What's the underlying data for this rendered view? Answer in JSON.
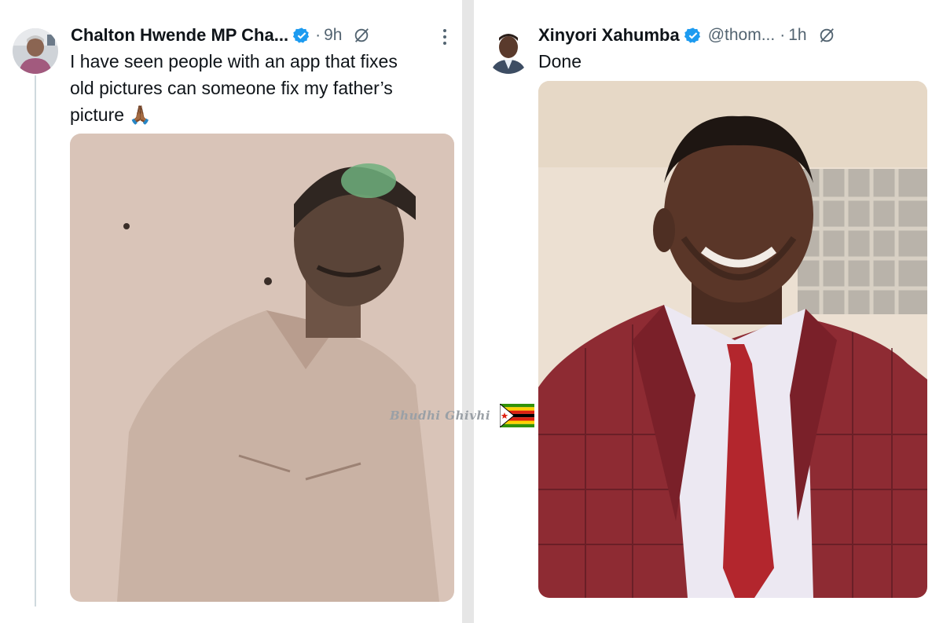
{
  "left_tweet": {
    "author_name": "Chalton Hwende MP Cha...",
    "time": "9h",
    "text_lines": [
      "I have seen people with an app that fixes",
      "old pictures can someone fix my father’s",
      "picture 🙏🏾"
    ],
    "avatar_icon": "avatar-photo",
    "verified_icon": "verified-badge-icon",
    "grok_icon": "grok-icon",
    "more_icon": "more-options-icon"
  },
  "right_tweet": {
    "author_name": "Xinyori Xahumba",
    "handle": "@thom...",
    "time": "1h",
    "text": "Done",
    "avatar_icon": "avatar-photo",
    "verified_icon": "verified-badge-icon",
    "grok_icon": "grok-icon"
  },
  "watermark": {
    "text": "Bhudhi Ghivhi",
    "flag_icon": "zimbabwe-flag-icon"
  },
  "colors": {
    "verified_blue": "#1d9bf0",
    "text_primary": "#0f1419",
    "text_secondary": "#536471"
  }
}
